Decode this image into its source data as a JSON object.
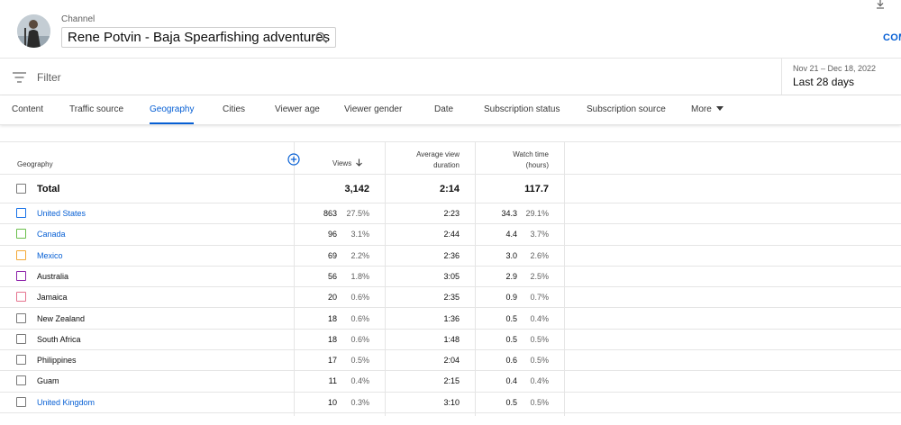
{
  "header": {
    "channel_label": "Channel",
    "channel_name": "Rene Potvin - Baja Spearfishing adventures",
    "compare_label": "COM"
  },
  "filter": {
    "placeholder": "Filter",
    "date_range": "Nov 21 – Dec 18, 2022",
    "date_period": "Last 28 days"
  },
  "tabs": [
    {
      "label": "Content"
    },
    {
      "label": "Traffic source"
    },
    {
      "label": "Geography",
      "active": true
    },
    {
      "label": "Cities"
    },
    {
      "label": "Viewer age"
    },
    {
      "label": "Viewer gender"
    },
    {
      "label": "Date"
    },
    {
      "label": "Subscription status"
    },
    {
      "label": "Subscription source"
    },
    {
      "label": "More"
    }
  ],
  "table": {
    "headers": {
      "geography": "Geography",
      "views": "Views",
      "avg_duration_1": "Average view",
      "avg_duration_2": "duration",
      "watch_time_1": "Watch time",
      "watch_time_2": "(hours)"
    },
    "total": {
      "label": "Total",
      "views": "3,142",
      "avg_duration": "2:14",
      "watch_time": "117.7"
    },
    "rows": [
      {
        "name": "United States",
        "link": true,
        "color": "#1a73e8",
        "views": "863",
        "views_pct": "27.5%",
        "avg_duration": "2:23",
        "watch_time": "34.3",
        "watch_pct": "29.1%"
      },
      {
        "name": "Canada",
        "link": true,
        "color": "#6abf4b",
        "views": "96",
        "views_pct": "3.1%",
        "avg_duration": "2:44",
        "watch_time": "4.4",
        "watch_pct": "3.7%"
      },
      {
        "name": "Mexico",
        "link": true,
        "color": "#f4a938",
        "views": "69",
        "views_pct": "2.2%",
        "avg_duration": "2:36",
        "watch_time": "3.0",
        "watch_pct": "2.6%"
      },
      {
        "name": "Australia",
        "link": false,
        "color": "#8e24aa",
        "views": "56",
        "views_pct": "1.8%",
        "avg_duration": "3:05",
        "watch_time": "2.9",
        "watch_pct": "2.5%"
      },
      {
        "name": "Jamaica",
        "link": false,
        "color": "#e5738f",
        "views": "20",
        "views_pct": "0.6%",
        "avg_duration": "2:35",
        "watch_time": "0.9",
        "watch_pct": "0.7%"
      },
      {
        "name": "New Zealand",
        "link": false,
        "color": "#7a7a7a",
        "views": "18",
        "views_pct": "0.6%",
        "avg_duration": "1:36",
        "watch_time": "0.5",
        "watch_pct": "0.4%"
      },
      {
        "name": "South Africa",
        "link": false,
        "color": "#7a7a7a",
        "views": "18",
        "views_pct": "0.6%",
        "avg_duration": "1:48",
        "watch_time": "0.5",
        "watch_pct": "0.5%"
      },
      {
        "name": "Philippines",
        "link": false,
        "color": "#7a7a7a",
        "views": "17",
        "views_pct": "0.5%",
        "avg_duration": "2:04",
        "watch_time": "0.6",
        "watch_pct": "0.5%"
      },
      {
        "name": "Guam",
        "link": false,
        "color": "#7a7a7a",
        "views": "11",
        "views_pct": "0.4%",
        "avg_duration": "2:15",
        "watch_time": "0.4",
        "watch_pct": "0.4%"
      },
      {
        "name": "United Kingdom",
        "link": true,
        "color": "#7a7a7a",
        "views": "10",
        "views_pct": "0.3%",
        "avg_duration": "3:10",
        "watch_time": "0.5",
        "watch_pct": "0.5%"
      }
    ]
  },
  "colors": {
    "accent": "#065fd4"
  }
}
